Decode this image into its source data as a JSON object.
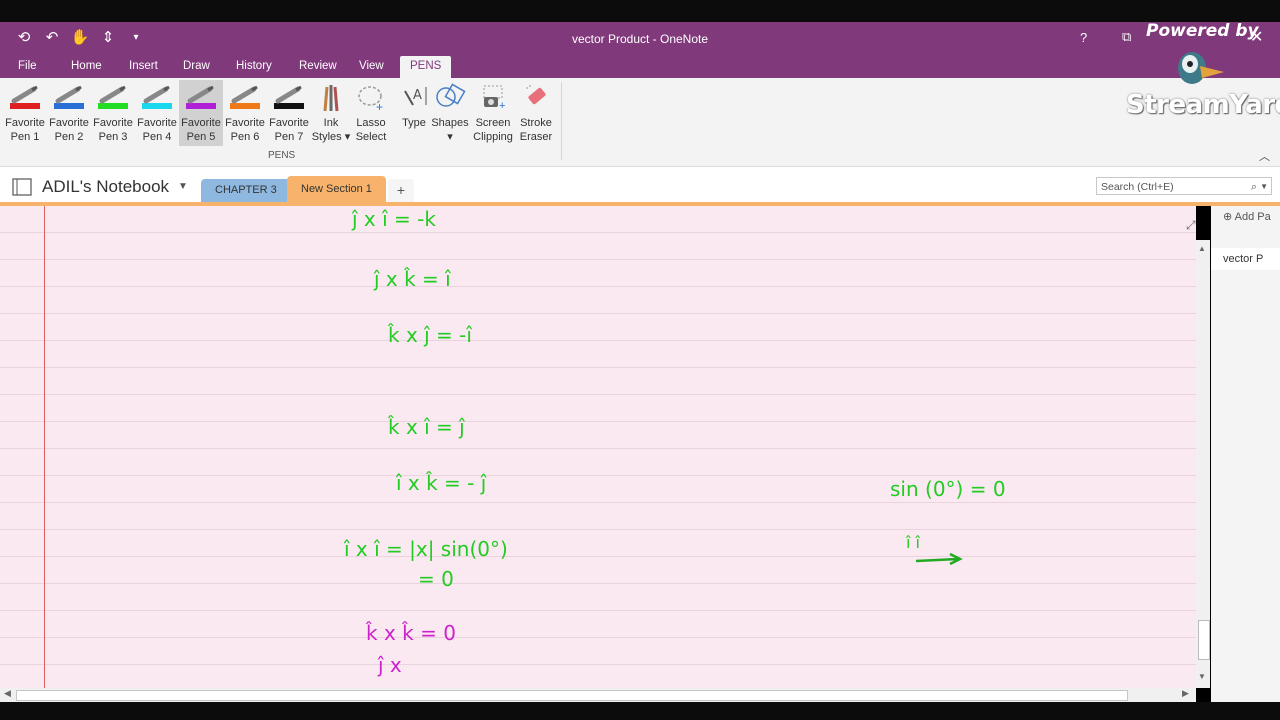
{
  "window": {
    "title": "vector Product - OneNote",
    "help": "?",
    "restore": "⧉",
    "close": "✕"
  },
  "overlay": {
    "powered_by": "Powered by",
    "brand": "StreamYard"
  },
  "ribbon_tabs": [
    "File",
    "Home",
    "Insert",
    "Draw",
    "History",
    "Review",
    "View",
    "PENS"
  ],
  "pens": [
    {
      "label": "Favorite\nPen 1",
      "color": "#e02020"
    },
    {
      "label": "Favorite\nPen 2",
      "color": "#2a6fd6"
    },
    {
      "label": "Favorite\nPen 3",
      "color": "#22dd22"
    },
    {
      "label": "Favorite\nPen 4",
      "color": "#18d8f0"
    },
    {
      "label": "Favorite\nPen 5",
      "color": "#b01ed8"
    },
    {
      "label": "Favorite\nPen 6",
      "color": "#f07a18"
    },
    {
      "label": "Favorite\nPen 7",
      "color": "#111111"
    }
  ],
  "tools": [
    {
      "label": "Ink\nStyles ▾",
      "icon": "ink-styles-icon"
    },
    {
      "label": "Lasso\nSelect",
      "icon": "lasso-icon"
    },
    {
      "label": "Type",
      "icon": "type-icon"
    },
    {
      "label": "Shapes\n▾",
      "icon": "shapes-icon"
    },
    {
      "label": "Screen\nClipping",
      "icon": "camera-icon"
    },
    {
      "label": "Stroke\nEraser",
      "icon": "eraser-icon"
    }
  ],
  "group_label": "PENS",
  "notebook": {
    "title": "ADIL's Notebook",
    "sections": [
      "CHAPTER 3",
      "New Section 1"
    ],
    "add": "+"
  },
  "search": {
    "placeholder": "Search (Ctrl+E)"
  },
  "pages_pane": {
    "add_page": "Add Pa",
    "page": "vector P"
  },
  "ink": {
    "green_color": "#22cc22",
    "magenta_color": "#cc22cc",
    "lines": [
      {
        "text": "ĵ x î = -k",
        "color": "green"
      },
      {
        "text": "ĵ x k̂ = î",
        "color": "green"
      },
      {
        "text": "k̂ x ĵ = -î",
        "color": "green"
      },
      {
        "text": "k̂ x î = ĵ",
        "color": "green"
      },
      {
        "text": "î x k̂ = - ĵ",
        "color": "green"
      },
      {
        "text": "î x î = |x| sin(0°)",
        "color": "green"
      },
      {
        "text": "= 0",
        "color": "green"
      },
      {
        "text": "k̂ x k̂ = 0",
        "color": "magenta"
      },
      {
        "text": "ĵ x",
        "color": "magenta"
      },
      {
        "text": "sin (0°) = 0",
        "color": "green"
      },
      {
        "text": "î î",
        "color": "green"
      }
    ]
  }
}
